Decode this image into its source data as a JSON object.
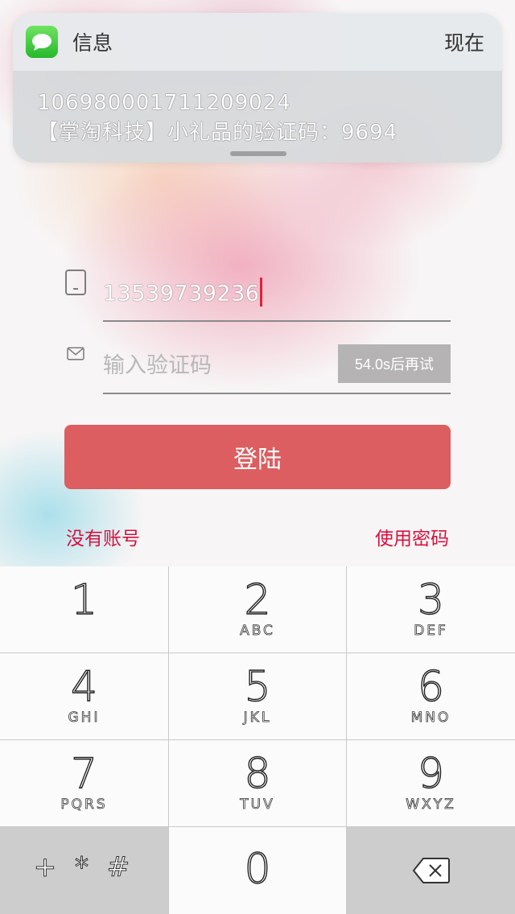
{
  "notification": {
    "app_name": "信息",
    "time": "现在",
    "sender": "106980001711209024",
    "message": "【掌淘科技】小礼品的验证码：9694",
    "icon": "messages-app-icon"
  },
  "form": {
    "phone_value": "13539739236",
    "code_placeholder": "输入验证码",
    "retry_label": "54.0s后再试",
    "login_label": "登陆",
    "no_account_label": "没有账号",
    "use_password_label": "使用密码"
  },
  "colors": {
    "accent": "#dc5e60",
    "link": "#d8123f",
    "caret": "#e0203c"
  },
  "keypad": {
    "keys": [
      {
        "digit": "1",
        "letters": ""
      },
      {
        "digit": "2",
        "letters": "ABC"
      },
      {
        "digit": "3",
        "letters": "DEF"
      },
      {
        "digit": "4",
        "letters": "GHI"
      },
      {
        "digit": "5",
        "letters": "JKL"
      },
      {
        "digit": "6",
        "letters": "MNO"
      },
      {
        "digit": "7",
        "letters": "PQRS"
      },
      {
        "digit": "8",
        "letters": "TUV"
      },
      {
        "digit": "9",
        "letters": "WXYZ"
      }
    ],
    "symbols_label": "+ * #",
    "zero": "0",
    "delete_icon": "backspace-icon"
  }
}
